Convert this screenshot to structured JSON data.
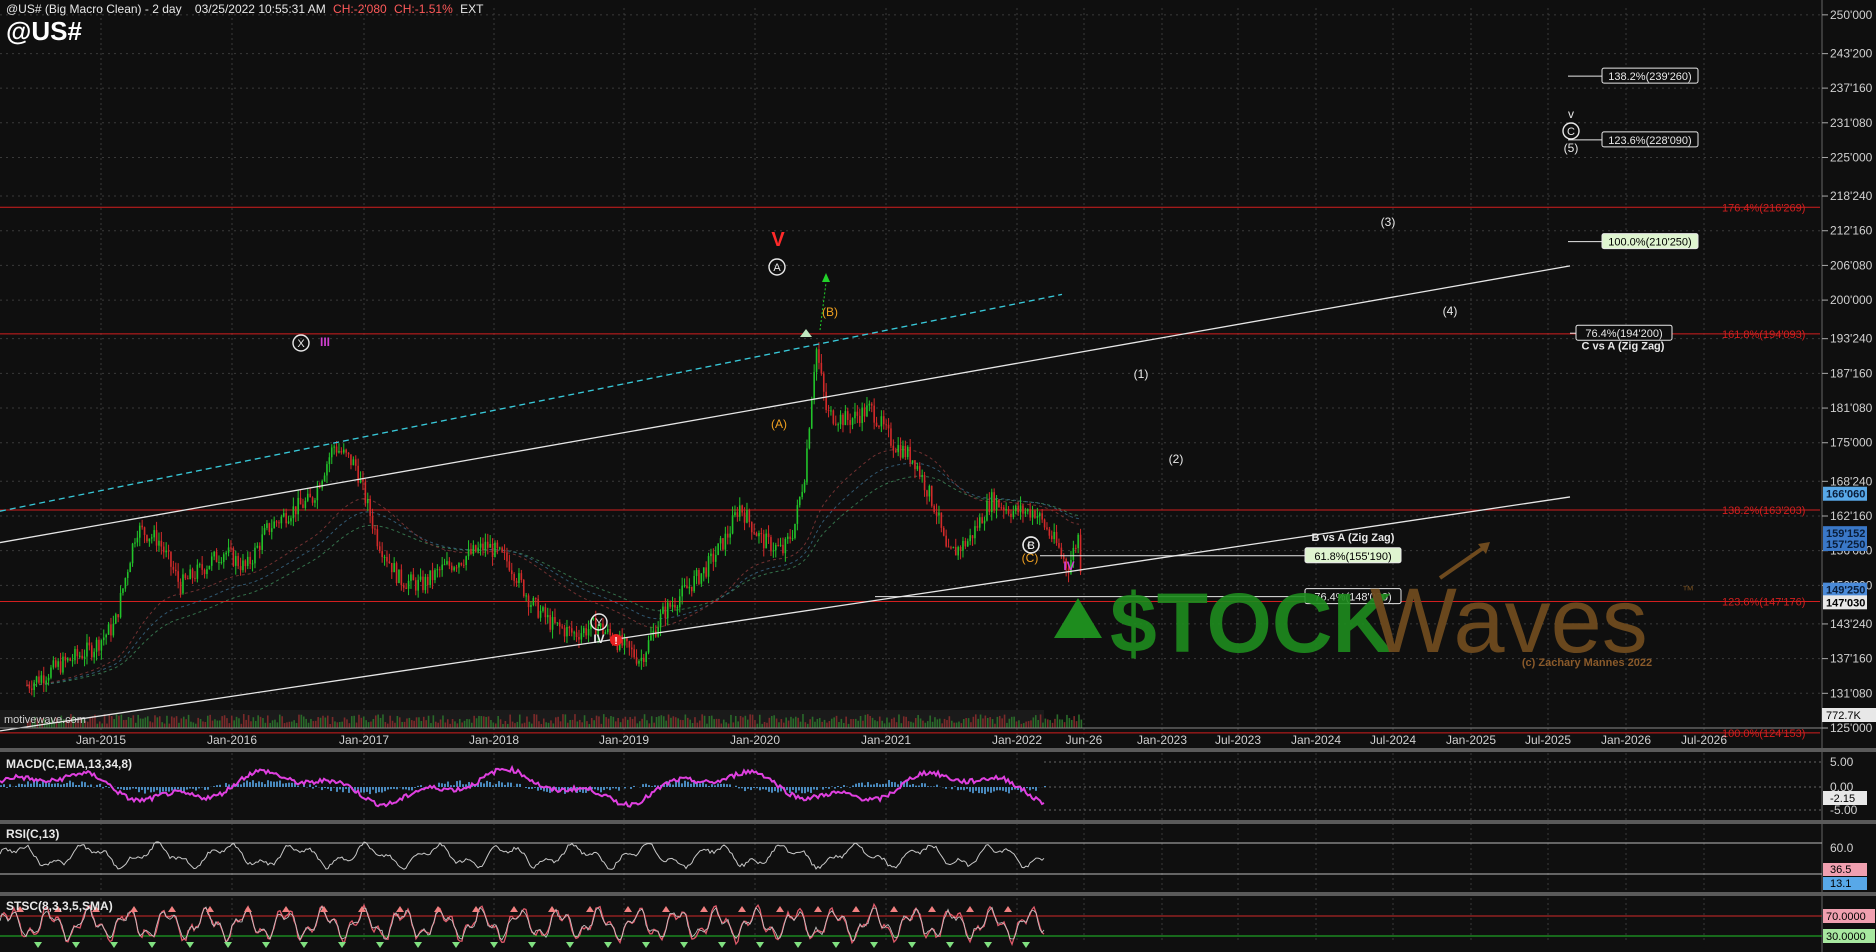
{
  "header": {
    "title": "@US# (Big Macro Clean) - 2 day",
    "datetime": "03/25/2022 10:55:31 AM",
    "change": "CH:-2'080",
    "change_pct": "CH:-1.51%",
    "session": "EXT",
    "symbol": "@US#",
    "watermark_site": "motivewave.com"
  },
  "colors": {
    "background": "#0f0f0f",
    "grid": "#3a3a3a",
    "fib_line": "#d21f1f",
    "channel_line": "#e6e6e6",
    "cyan_trend": "#38c8d8",
    "up_candle": "#22c32a",
    "down_candle": "#d22a2a",
    "macd_line": "#e040e0",
    "macd_hist": "#58a8e8",
    "stockwaves_green": "#1e8c1e",
    "stockwaves_brown": "#6e4a1e"
  },
  "chart_data": {
    "type": "line",
    "title": "@US# (Big Macro Clean) - 2 day",
    "x_labels": [
      "Jan-2015",
      "Jan-2016",
      "Jan-2017",
      "Jan-2018",
      "Jan-2019",
      "Jan-2020",
      "Jan-2021",
      "Jan-2022",
      "Jun-26",
      "Jan-2023",
      "Jul-2023",
      "Jan-2024",
      "Jul-2024",
      "Jan-2025",
      "Jul-2025",
      "Jan-2026",
      "Jul-2026"
    ],
    "y_labels": [
      "250'000",
      "243'200",
      "237'160",
      "231'080",
      "225'000",
      "218'240",
      "212'160",
      "206'080",
      "200'000",
      "193'240",
      "187'160",
      "181'080",
      "175'000",
      "168'240",
      "162'160",
      "156'080",
      "150'000",
      "143'240",
      "137'160",
      "131'080",
      "125'000"
    ],
    "ylim": [
      125,
      251.2
    ],
    "price_series": {
      "name": "@US#",
      "points": [
        [
          "2014-03",
          132.5
        ],
        [
          "2014-06",
          136
        ],
        [
          "2014-09",
          139
        ],
        [
          "2014-11",
          143
        ],
        [
          "2015-01",
          160
        ],
        [
          "2015-03",
          158
        ],
        [
          "2015-05",
          150
        ],
        [
          "2015-07",
          153
        ],
        [
          "2015-09",
          156
        ],
        [
          "2015-11",
          153
        ],
        [
          "2016-01",
          160
        ],
        [
          "2016-03",
          163
        ],
        [
          "2016-05",
          165
        ],
        [
          "2016-07",
          174.5
        ],
        [
          "2016-09",
          171
        ],
        [
          "2016-11",
          158
        ],
        [
          "2017-01",
          151
        ],
        [
          "2017-03",
          150
        ],
        [
          "2017-05",
          153
        ],
        [
          "2017-07",
          155
        ],
        [
          "2017-09",
          157
        ],
        [
          "2017-11",
          154
        ],
        [
          "2018-01",
          147
        ],
        [
          "2018-03",
          143
        ],
        [
          "2018-05",
          141.5
        ],
        [
          "2018-07",
          143
        ],
        [
          "2018-09",
          140
        ],
        [
          "2018-11",
          137
        ],
        [
          "2019-01",
          145
        ],
        [
          "2019-03",
          149
        ],
        [
          "2019-05",
          153
        ],
        [
          "2019-07",
          159
        ],
        [
          "2019-08",
          164
        ],
        [
          "2019-10",
          158
        ],
        [
          "2019-12",
          156
        ],
        [
          "2020-01",
          160
        ],
        [
          "2020-02",
          170
        ],
        [
          "2020-03",
          192
        ],
        [
          "2020-04",
          180
        ],
        [
          "2020-06",
          179
        ],
        [
          "2020-08",
          181
        ],
        [
          "2020-10",
          175
        ],
        [
          "2020-12",
          172
        ],
        [
          "2021-02",
          163
        ],
        [
          "2021-03",
          155
        ],
        [
          "2021-05",
          158
        ],
        [
          "2021-07",
          165
        ],
        [
          "2021-09",
          163
        ],
        [
          "2021-11",
          163
        ],
        [
          "2022-01",
          157
        ],
        [
          "2022-02",
          153
        ],
        [
          "2022-03",
          159
        ],
        [
          "2022-03-25",
          147
        ]
      ]
    },
    "last_price": "147'030",
    "price_tags": [
      "166'060",
      "159'152",
      "157'250",
      "149'250",
      "147'030"
    ],
    "fib_levels": [
      {
        "label": "176.4%(216'269)",
        "value": 216.27
      },
      {
        "label": "161.8%(194'093)",
        "value": 194.09
      },
      {
        "label": "138.2%(163'203)",
        "value": 163.2
      },
      {
        "label": "123.6%(147'176)",
        "value": 147.18
      },
      {
        "label": "100.0%(124'153)",
        "value": 124.15
      }
    ],
    "targets": [
      {
        "label": "138.2%(239'260)",
        "value": 239.26
      },
      {
        "label": "123.6%(228'090)",
        "value": 228.09
      },
      {
        "label": "100.0%(210'250)",
        "value": 210.25
      },
      {
        "label": "76.4%(194'200)",
        "value": 194.2
      },
      {
        "label": "61.8%(155'190)",
        "value": 155.19
      },
      {
        "label": "76.4%(148'030)",
        "value": 148.03
      }
    ],
    "annotations": {
      "c_vs_a": "C vs A (Zig Zag)",
      "b_vs_a": "B vs A (Zig Zag)",
      "copyright": "(c) Zachary Mannes 2022"
    },
    "waves": {
      "V": "V",
      "A": "A",
      "B_orange": "(B)",
      "A_orange": "(A)",
      "C_orange": "(C)",
      "B": "B",
      "X": "X",
      "III": "III",
      "Y": "Y",
      "IV": "IV",
      "IV_magenta": "IV",
      "w1": "(1)",
      "w2": "(2)",
      "w3": "(3)",
      "w4": "(4)",
      "w5": "(5)",
      "v_small": "v",
      "C": "C"
    },
    "volume": {
      "label": "772.7K"
    },
    "macd": {
      "label": "MACD(C,EMA,13,34,8)",
      "ticks": [
        "5.00",
        "0.00",
        "-5.00"
      ],
      "tag": "-2.15"
    },
    "rsi": {
      "label": "RSI(C,13)",
      "ticks": [
        "60.0"
      ],
      "tags": [
        "36.5",
        "13.1"
      ]
    },
    "stoch": {
      "label": "STSC(8,3,3,5,SMA)",
      "ticks": [
        "70.0000",
        "30.0000"
      ]
    }
  },
  "logo": {
    "stock": "$TOCK",
    "waves": "Waves",
    "tm": "™"
  }
}
